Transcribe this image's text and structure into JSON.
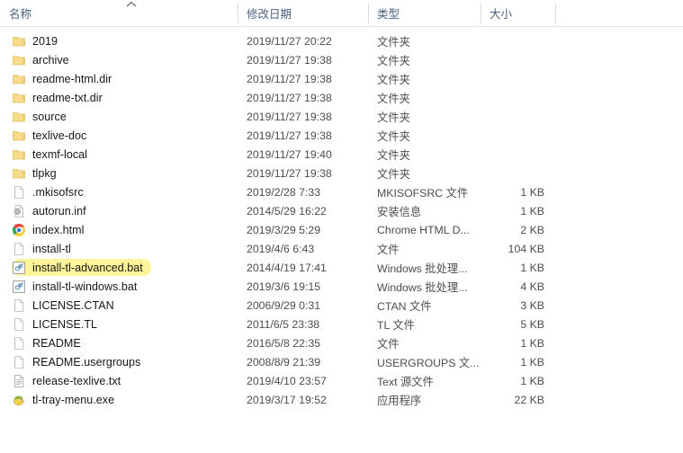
{
  "columns": {
    "name": "名称",
    "date": "修改日期",
    "type": "类型",
    "size": "大小",
    "sort_indicator": "ascending-caret"
  },
  "colors": {
    "selection_highlight": "#fdf59a",
    "header_text": "#4a6180",
    "folder_icon": "#f7d87c",
    "row_text": "#161616",
    "secondary_text": "#4d4d4d",
    "divider": "#d9d9d9"
  },
  "rows": [
    {
      "name": "2019",
      "icon": "folder-icon",
      "date": "2019/11/27 20:22",
      "type": "文件夹",
      "size": "",
      "selected": false
    },
    {
      "name": "archive",
      "icon": "folder-icon",
      "date": "2019/11/27 19:38",
      "type": "文件夹",
      "size": "",
      "selected": false
    },
    {
      "name": "readme-html.dir",
      "icon": "folder-icon",
      "date": "2019/11/27 19:38",
      "type": "文件夹",
      "size": "",
      "selected": false
    },
    {
      "name": "readme-txt.dir",
      "icon": "folder-icon",
      "date": "2019/11/27 19:38",
      "type": "文件夹",
      "size": "",
      "selected": false
    },
    {
      "name": "source",
      "icon": "folder-icon",
      "date": "2019/11/27 19:38",
      "type": "文件夹",
      "size": "",
      "selected": false
    },
    {
      "name": "texlive-doc",
      "icon": "folder-icon",
      "date": "2019/11/27 19:38",
      "type": "文件夹",
      "size": "",
      "selected": false
    },
    {
      "name": "texmf-local",
      "icon": "folder-icon",
      "date": "2019/11/27 19:40",
      "type": "文件夹",
      "size": "",
      "selected": false
    },
    {
      "name": "tlpkg",
      "icon": "folder-icon",
      "date": "2019/11/27 19:38",
      "type": "文件夹",
      "size": "",
      "selected": false
    },
    {
      "name": ".mkisofsrc",
      "icon": "blank-file-icon",
      "date": "2019/2/28 7:33",
      "type": "MKISOFSRC 文件",
      "size": "1 KB",
      "selected": false
    },
    {
      "name": "autorun.inf",
      "icon": "setup-info-icon",
      "date": "2014/5/29 16:22",
      "type": "安装信息",
      "size": "1 KB",
      "selected": false
    },
    {
      "name": "index.html",
      "icon": "chrome-icon",
      "date": "2019/3/29 5:29",
      "type": "Chrome HTML D...",
      "size": "2 KB",
      "selected": false
    },
    {
      "name": "install-tl",
      "icon": "blank-file-icon",
      "date": "2019/4/6 6:43",
      "type": "文件",
      "size": "104 KB",
      "selected": false
    },
    {
      "name": "install-tl-advanced.bat",
      "icon": "batch-file-icon",
      "date": "2014/4/19 17:41",
      "type": "Windows 批处理...",
      "size": "1 KB",
      "selected": true
    },
    {
      "name": "install-tl-windows.bat",
      "icon": "batch-file-icon",
      "date": "2019/3/6 19:15",
      "type": "Windows 批处理...",
      "size": "4 KB",
      "selected": false
    },
    {
      "name": "LICENSE.CTAN",
      "icon": "blank-file-icon",
      "date": "2006/9/29 0:31",
      "type": "CTAN 文件",
      "size": "3 KB",
      "selected": false
    },
    {
      "name": "LICENSE.TL",
      "icon": "blank-file-icon",
      "date": "2011/6/5 23:38",
      "type": "TL 文件",
      "size": "5 KB",
      "selected": false
    },
    {
      "name": "README",
      "icon": "blank-file-icon",
      "date": "2016/5/8 22:35",
      "type": "文件",
      "size": "1 KB",
      "selected": false
    },
    {
      "name": "README.usergroups",
      "icon": "blank-file-icon",
      "date": "2008/8/9 21:39",
      "type": "USERGROUPS 文...",
      "size": "1 KB",
      "selected": false
    },
    {
      "name": "release-texlive.txt",
      "icon": "text-file-icon",
      "date": "2019/4/10 23:57",
      "type": "Text 源文件",
      "size": "1 KB",
      "selected": false
    },
    {
      "name": "tl-tray-menu.exe",
      "icon": "bird-app-icon",
      "date": "2019/3/17 19:52",
      "type": "应用程序",
      "size": "22 KB",
      "selected": false
    }
  ]
}
